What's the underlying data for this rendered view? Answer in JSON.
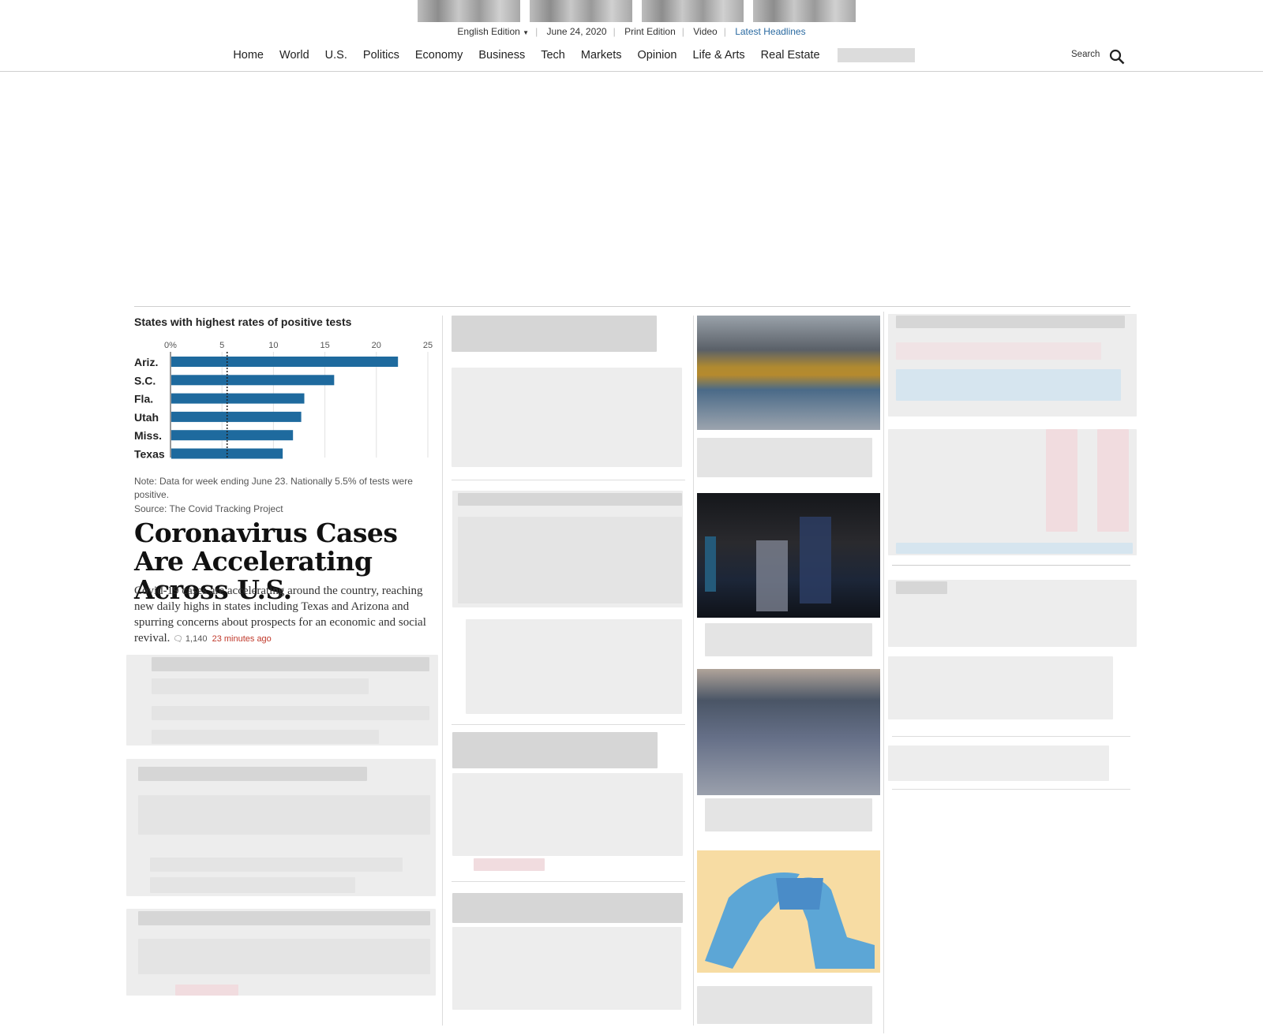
{
  "masthead": {
    "edition": "English Edition",
    "edition_caret": "▼",
    "date": "June 24, 2020",
    "print_edition": "Print Edition",
    "video": "Video",
    "latest_headlines": "Latest Headlines"
  },
  "nav": {
    "items": [
      "Home",
      "World",
      "U.S.",
      "Politics",
      "Economy",
      "Business",
      "Tech",
      "Markets",
      "Opinion",
      "Life & Arts",
      "Real Estate"
    ],
    "search_label": "Search"
  },
  "lead_story": {
    "headline": "Coronavirus Cases Are Accelerating Across U.S.",
    "summary": "Covid-19 cases are accelerating around the country, reaching new daily highs in states including Texas and Arizona and spurring concerns about prospects for an economic and social revival.",
    "comments_count": "1,140",
    "time_ago": "23 minutes ago"
  },
  "chart_data": {
    "type": "bar",
    "title": "States with highest rates of positive tests",
    "categories": [
      "Ariz.",
      "S.C.",
      "Fla.",
      "Utah",
      "Miss.",
      "Texas"
    ],
    "values": [
      22.1,
      15.9,
      13.0,
      12.7,
      11.9,
      10.9
    ],
    "xlim": [
      0,
      25
    ],
    "ticks": [
      "0%",
      "5",
      "10",
      "15",
      "20",
      "25"
    ],
    "reference_value": 5.5,
    "bar_color": "#1e6a9e",
    "note": "Note: Data for week ending June 23. Nationally 5.5% of tests were positive.",
    "source": "Source: The Covid Tracking Project"
  },
  "colors": {
    "link_blue": "#2a6aa1",
    "time_red": "#c0392b",
    "bar_blue": "#1e6a9e"
  }
}
